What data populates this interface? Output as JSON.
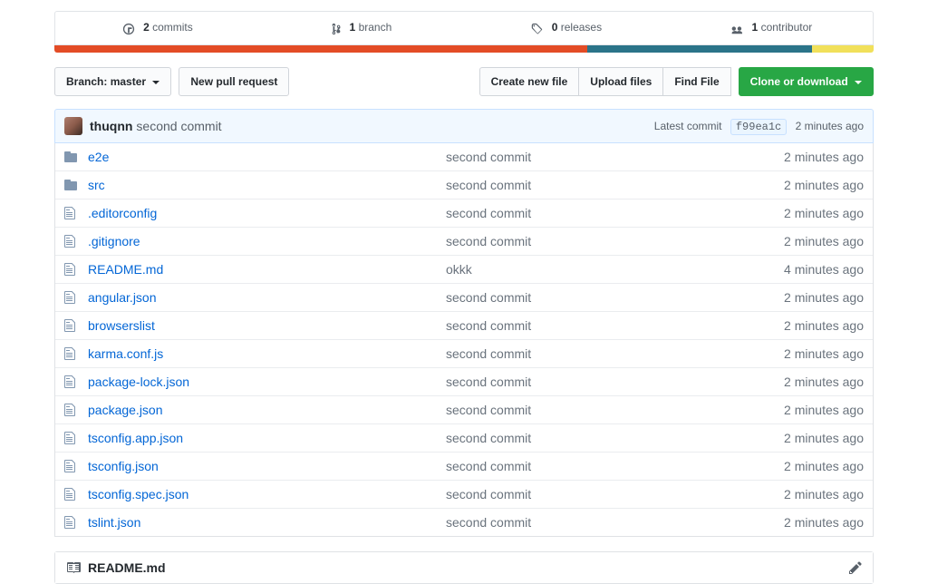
{
  "stats": {
    "commits_count": "2",
    "commits_label": "commits",
    "branches_count": "1",
    "branches_label": "branch",
    "releases_count": "0",
    "releases_label": "releases",
    "contributors_count": "1",
    "contributors_label": "contributor"
  },
  "toolbar": {
    "branch_prefix": "Branch:",
    "branch_name": "master",
    "new_pr": "New pull request",
    "create_file": "Create new file",
    "upload_files": "Upload files",
    "find_file": "Find File",
    "clone": "Clone or download"
  },
  "latest_commit": {
    "author": "thuqnn",
    "message": "second commit",
    "label": "Latest commit",
    "sha": "f99ea1c",
    "time": "2 minutes ago"
  },
  "files": [
    {
      "type": "dir",
      "name": "e2e",
      "msg": "second commit",
      "time": "2 minutes ago"
    },
    {
      "type": "dir",
      "name": "src",
      "msg": "second commit",
      "time": "2 minutes ago"
    },
    {
      "type": "file",
      "name": ".editorconfig",
      "msg": "second commit",
      "time": "2 minutes ago"
    },
    {
      "type": "file",
      "name": ".gitignore",
      "msg": "second commit",
      "time": "2 minutes ago"
    },
    {
      "type": "file",
      "name": "README.md",
      "msg": "okkk",
      "time": "4 minutes ago"
    },
    {
      "type": "file",
      "name": "angular.json",
      "msg": "second commit",
      "time": "2 minutes ago"
    },
    {
      "type": "file",
      "name": "browserslist",
      "msg": "second commit",
      "time": "2 minutes ago"
    },
    {
      "type": "file",
      "name": "karma.conf.js",
      "msg": "second commit",
      "time": "2 minutes ago"
    },
    {
      "type": "file",
      "name": "package-lock.json",
      "msg": "second commit",
      "time": "2 minutes ago"
    },
    {
      "type": "file",
      "name": "package.json",
      "msg": "second commit",
      "time": "2 minutes ago"
    },
    {
      "type": "file",
      "name": "tsconfig.app.json",
      "msg": "second commit",
      "time": "2 minutes ago"
    },
    {
      "type": "file",
      "name": "tsconfig.json",
      "msg": "second commit",
      "time": "2 minutes ago"
    },
    {
      "type": "file",
      "name": "tsconfig.spec.json",
      "msg": "second commit",
      "time": "2 minutes ago"
    },
    {
      "type": "file",
      "name": "tslint.json",
      "msg": "second commit",
      "time": "2 minutes ago"
    }
  ],
  "readme": {
    "filename": "README.md"
  }
}
